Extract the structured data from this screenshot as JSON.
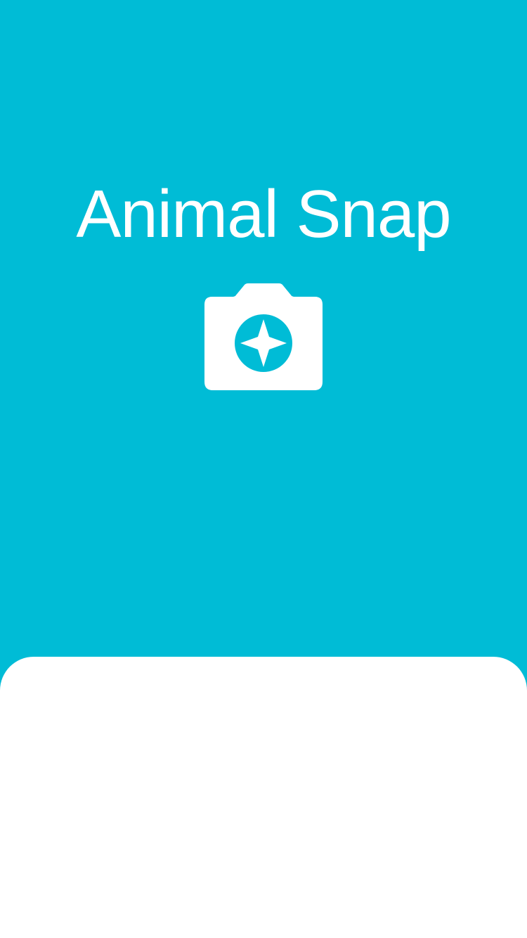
{
  "app": {
    "title": "Animal Snap",
    "logo_icon": "camera-sparkle-icon"
  },
  "colors": {
    "brand": "#00BCD6",
    "foreground": "#FFFFFF",
    "sheet": "#FFFFFF"
  }
}
